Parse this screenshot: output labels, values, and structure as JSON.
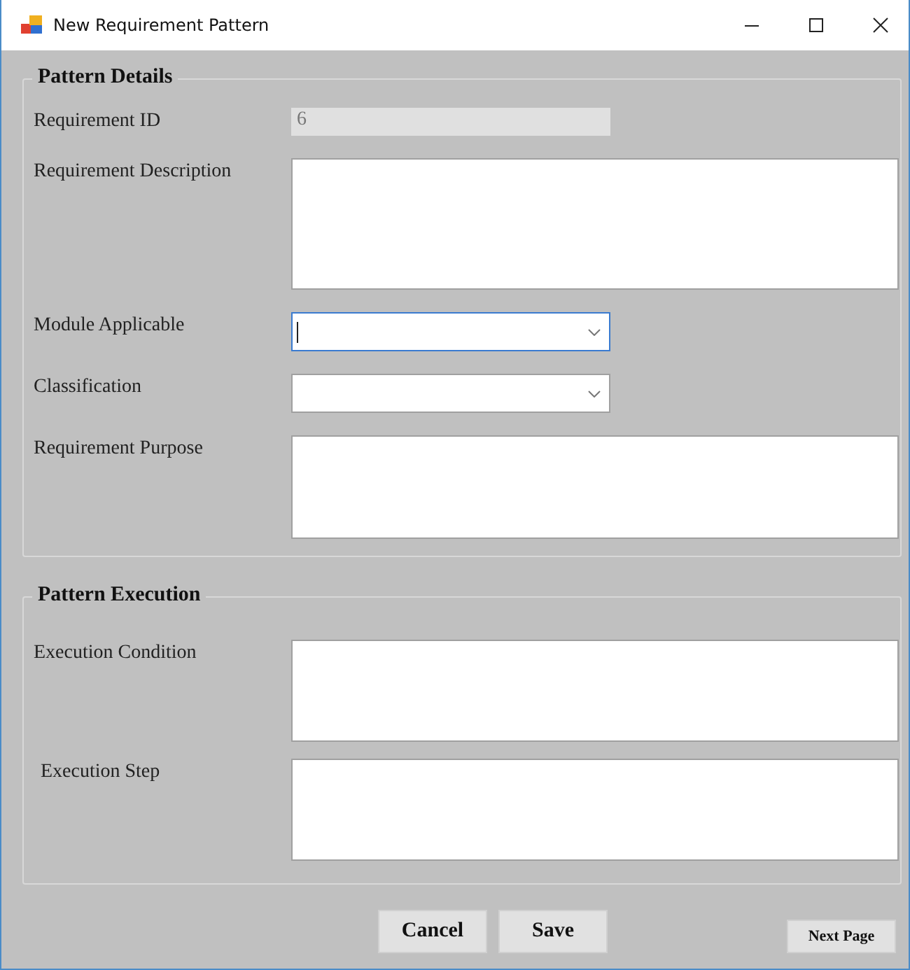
{
  "window": {
    "title": "New Requirement Pattern"
  },
  "groups": [
    {
      "title": "Pattern Details",
      "fields": [
        {
          "label": "Requirement ID",
          "kind": "text",
          "value": "6",
          "disabled": true,
          "focused": false
        },
        {
          "label": "Requirement Description",
          "kind": "textarea",
          "disabled": false,
          "focused": false
        },
        {
          "label": "Module Applicable",
          "kind": "combo",
          "disabled": false,
          "focused": true
        },
        {
          "label": "Classification",
          "kind": "combo",
          "disabled": false,
          "focused": false
        },
        {
          "label": "Requirement Purpose",
          "kind": "textarea",
          "disabled": false,
          "focused": false
        }
      ]
    },
    {
      "title": "Pattern Execution",
      "fields": [
        {
          "label": "Execution Condition",
          "kind": "textarea",
          "disabled": false,
          "focused": false
        },
        {
          "label": "Execution Step",
          "kind": "textarea",
          "disabled": false,
          "focused": false
        }
      ]
    }
  ],
  "buttons": [
    "Cancel",
    "Save"
  ],
  "next_button": "Next Page"
}
